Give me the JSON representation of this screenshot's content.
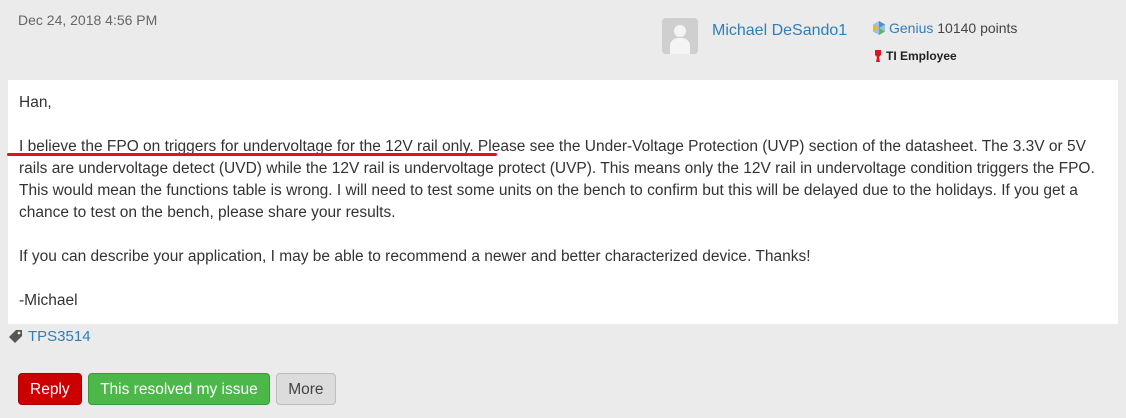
{
  "post": {
    "date": "Dec 24, 2018 4:56 PM",
    "author": {
      "name": "Michael DeSando1",
      "rank": "Genius",
      "points": "10140 points",
      "badge": "TI Employee"
    },
    "paragraphs": [
      "Han,",
      "I believe the FPO on triggers for undervoltage for the 12V rail only. Please see the Under-Voltage Protection (UVP) section of the datasheet. The 3.3V or 5V rails are undervoltage detect (UVD) while the 12V rail is undervoltage protect (UVP). This means only the 12V rail in undervoltage condition triggers the FPO. This would mean the functions table is wrong. I will need to test some units on the bench to confirm but this will be delayed due to the holidays. If you get a chance to test on the bench, please share your results.",
      "If you can describe your application, I may be able to recommend a newer and better characterized device. Thanks!",
      "-Michael"
    ],
    "tag": "TPS3514"
  },
  "actions": {
    "reply": "Reply",
    "resolved": "This resolved my issue",
    "more": "More"
  },
  "colors": {
    "link": "#2e7fb8",
    "reply": "#cc0000",
    "resolved": "#4cb849",
    "annotation": "#e0141e"
  },
  "icons": {
    "avatar": "default-user-avatar",
    "rank": "genius-rank-icon",
    "badge": "ti-logo-icon",
    "tag": "tag-icon"
  }
}
